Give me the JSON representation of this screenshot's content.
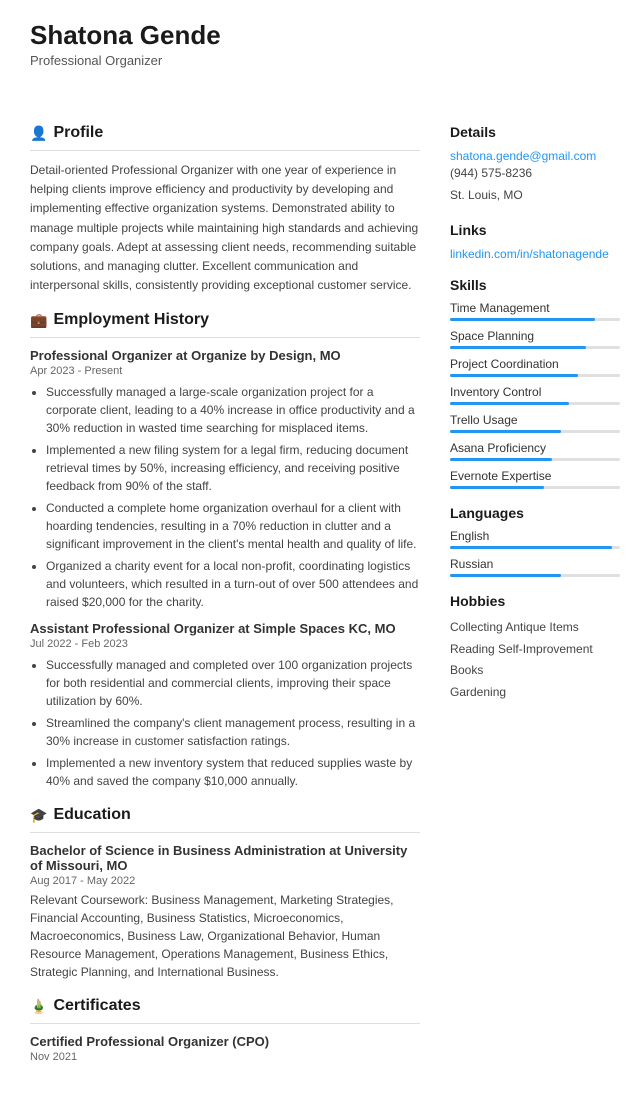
{
  "header": {
    "name": "Shatona Gende",
    "title": "Professional Organizer"
  },
  "profile": {
    "section_label": "Profile",
    "icon": "👤",
    "text": "Detail-oriented Professional Organizer with one year of experience in helping clients improve efficiency and productivity by developing and implementing effective organization systems. Demonstrated ability to manage multiple projects while maintaining high standards and achieving company goals. Adept at assessing client needs, recommending suitable solutions, and managing clutter. Excellent communication and interpersonal skills, consistently providing exceptional customer service."
  },
  "employment": {
    "section_label": "Employment History",
    "icon": "💼",
    "jobs": [
      {
        "title": "Professional Organizer at Organize by Design, MO",
        "dates": "Apr 2023 - Present",
        "bullets": [
          "Successfully managed a large-scale organization project for a corporate client, leading to a 40% increase in office productivity and a 30% reduction in wasted time searching for misplaced items.",
          "Implemented a new filing system for a legal firm, reducing document retrieval times by 50%, increasing efficiency, and receiving positive feedback from 90% of the staff.",
          "Conducted a complete home organization overhaul for a client with hoarding tendencies, resulting in a 70% reduction in clutter and a significant improvement in the client's mental health and quality of life.",
          "Organized a charity event for a local non-profit, coordinating logistics and volunteers, which resulted in a turn-out of over 500 attendees and raised $20,000 for the charity."
        ]
      },
      {
        "title": "Assistant Professional Organizer at Simple Spaces KC, MO",
        "dates": "Jul 2022 - Feb 2023",
        "bullets": [
          "Successfully managed and completed over 100 organization projects for both residential and commercial clients, improving their space utilization by 60%.",
          "Streamlined the company's client management process, resulting in a 30% increase in customer satisfaction ratings.",
          "Implemented a new inventory system that reduced supplies waste by 40% and saved the company $10,000 annually."
        ]
      }
    ]
  },
  "education": {
    "section_label": "Education",
    "icon": "🎓",
    "items": [
      {
        "degree": "Bachelor of Science in Business Administration at University of Missouri, MO",
        "dates": "Aug 2017 - May 2022",
        "text": "Relevant Coursework: Business Management, Marketing Strategies, Financial Accounting, Business Statistics, Microeconomics, Macroeconomics, Business Law, Organizational Behavior, Human Resource Management, Operations Management, Business Ethics, Strategic Planning, and International Business."
      }
    ]
  },
  "certificates": {
    "section_label": "Certificates",
    "icon": "🏅",
    "items": [
      {
        "title": "Certified Professional Organizer (CPO)",
        "date": "Nov 2021"
      }
    ]
  },
  "details": {
    "section_label": "Details",
    "email": "shatona.gende@gmail.com",
    "phone": "(944) 575-8236",
    "location": "St. Louis, MO"
  },
  "links": {
    "section_label": "Links",
    "linkedin": "linkedin.com/in/shatonagende"
  },
  "skills": {
    "section_label": "Skills",
    "items": [
      {
        "name": "Time Management",
        "level": 85
      },
      {
        "name": "Space Planning",
        "level": 80
      },
      {
        "name": "Project Coordination",
        "level": 75
      },
      {
        "name": "Inventory Control",
        "level": 70
      },
      {
        "name": "Trello Usage",
        "level": 65
      },
      {
        "name": "Asana Proficiency",
        "level": 60
      },
      {
        "name": "Evernote Expertise",
        "level": 55
      }
    ]
  },
  "languages": {
    "section_label": "Languages",
    "items": [
      {
        "name": "English",
        "level": 95
      },
      {
        "name": "Russian",
        "level": 65
      }
    ]
  },
  "hobbies": {
    "section_label": "Hobbies",
    "items": [
      "Collecting Antique Items",
      "Reading Self-Improvement Books",
      "Gardening"
    ]
  }
}
